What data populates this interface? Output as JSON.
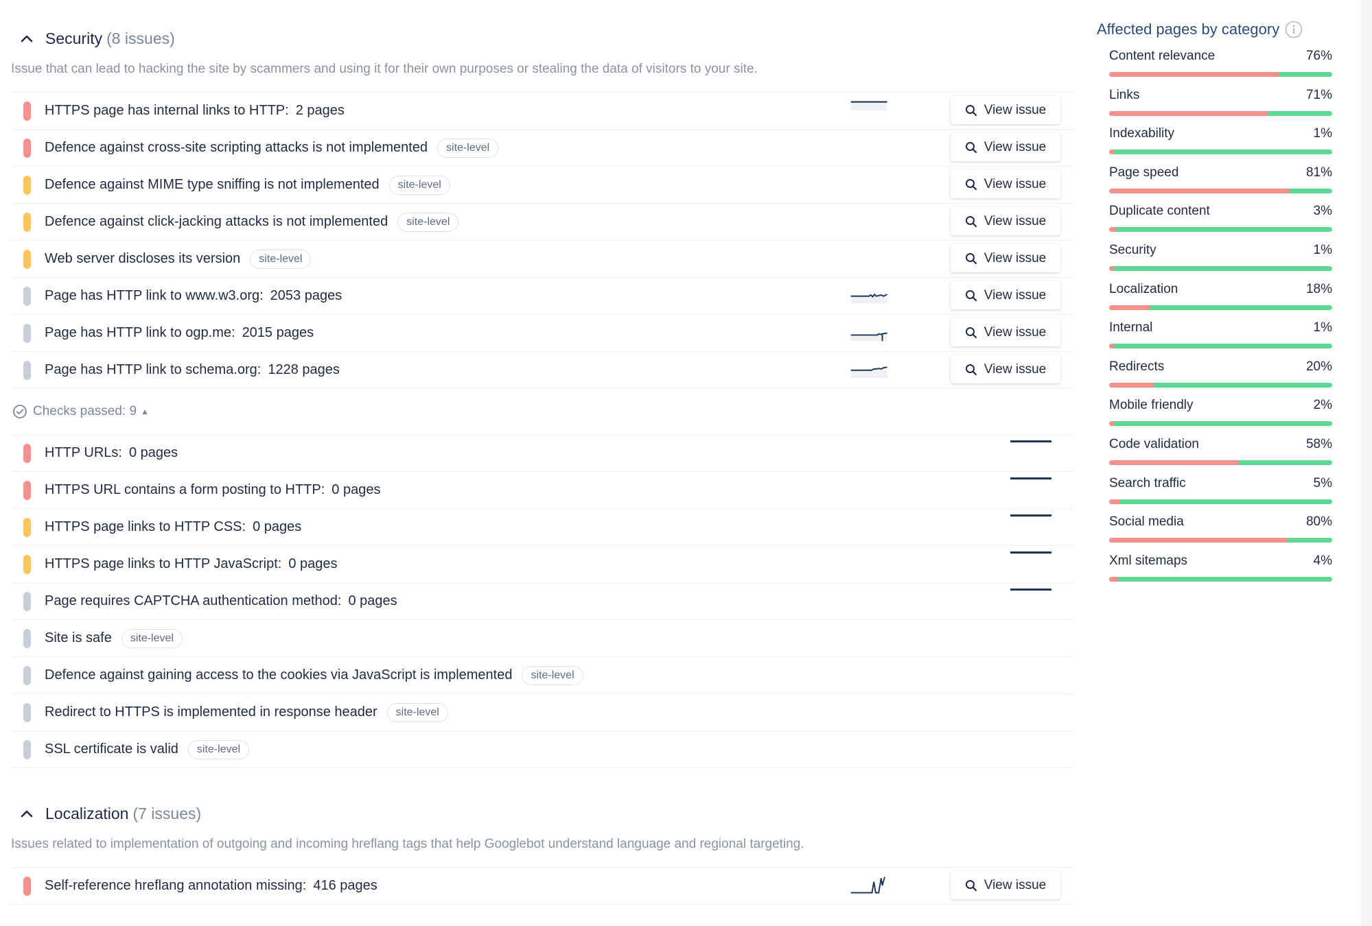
{
  "security": {
    "title": "Security",
    "count": "(8 issues)",
    "description": "Issue that can lead to hacking the site by scammers and using it for their own purposes or stealing the data of visitors to your site.",
    "issues": [
      {
        "severity": "red",
        "title": "HTTPS page has internal links to HTTP:",
        "count": "2 pages",
        "sparkline": "flat-low"
      },
      {
        "severity": "red",
        "title": "Defence against cross-site scripting attacks is not implemented",
        "tag": "site-level"
      },
      {
        "severity": "orange",
        "title": "Defence against MIME type sniffing is not implemented",
        "tag": "site-level"
      },
      {
        "severity": "orange",
        "title": "Defence against click-jacking attacks is not implemented",
        "tag": "site-level"
      },
      {
        "severity": "orange",
        "title": "Web server discloses its version",
        "tag": "site-level"
      },
      {
        "severity": "grey",
        "title": "Page has HTTP link to www.w3.org:",
        "count": "2053 pages",
        "sparkline": "wave"
      },
      {
        "severity": "grey",
        "title": "Page has HTTP link to ogp.me:",
        "count": "2015 pages",
        "sparkline": "hook"
      },
      {
        "severity": "grey",
        "title": "Page has HTTP link to schema.org:",
        "count": "1228 pages",
        "sparkline": "rise"
      }
    ],
    "view_label": "View issue",
    "checks_passed_label": "Checks passed: 9",
    "passed": [
      {
        "severity": "red",
        "title": "HTTP URLs:",
        "count": "0 pages",
        "flat": true
      },
      {
        "severity": "red",
        "title": "HTTPS URL contains a form posting to HTTP:",
        "count": "0 pages",
        "flat": true
      },
      {
        "severity": "orange",
        "title": "HTTPS page links to HTTP CSS:",
        "count": "0 pages",
        "flat": true
      },
      {
        "severity": "orange",
        "title": "HTTPS page links to HTTP JavaScript:",
        "count": "0 pages",
        "flat": true
      },
      {
        "severity": "grey",
        "title": "Page requires CAPTCHA authentication method:",
        "count": "0 pages",
        "flat": true
      },
      {
        "severity": "grey",
        "title": "Site is safe",
        "tag": "site-level"
      },
      {
        "severity": "grey",
        "title": "Defence against gaining access to the cookies via JavaScript is implemented",
        "tag": "site-level"
      },
      {
        "severity": "grey",
        "title": "Redirect to HTTPS is implemented in response header",
        "tag": "site-level"
      },
      {
        "severity": "grey",
        "title": "SSL certificate is valid",
        "tag": "site-level"
      }
    ]
  },
  "localization": {
    "title": "Localization",
    "count": "(7 issues)",
    "description": "Issues related to implementation of outgoing and incoming hreflang tags that help Googlebot understand language and regional targeting.",
    "issues": [
      {
        "severity": "red",
        "title": "Self-reference hreflang annotation missing:",
        "count": "416 pages",
        "sparkline": "spike"
      }
    ]
  },
  "sidebar": {
    "title": "Affected pages by category",
    "categories": [
      {
        "name": "Content relevance",
        "value": "76%",
        "pct": 76
      },
      {
        "name": "Links",
        "value": "71%",
        "pct": 71
      },
      {
        "name": "Indexability",
        "value": "1%",
        "pct": 1
      },
      {
        "name": "Page speed",
        "value": "81%",
        "pct": 81
      },
      {
        "name": "Duplicate content",
        "value": "3%",
        "pct": 3
      },
      {
        "name": "Security",
        "value": "1%",
        "pct": 1
      },
      {
        "name": "Localization",
        "value": "18%",
        "pct": 18
      },
      {
        "name": "Internal",
        "value": "1%",
        "pct": 1
      },
      {
        "name": "Redirects",
        "value": "20%",
        "pct": 20
      },
      {
        "name": "Mobile friendly",
        "value": "2%",
        "pct": 2
      },
      {
        "name": "Code validation",
        "value": "58%",
        "pct": 58
      },
      {
        "name": "Search traffic",
        "value": "5%",
        "pct": 5
      },
      {
        "name": "Social media",
        "value": "80%",
        "pct": 80
      },
      {
        "name": "Xml sitemaps",
        "value": "4%",
        "pct": 4
      }
    ]
  },
  "colors": {
    "red": "#f78f8f",
    "orange": "#ffc55c",
    "grey": "#c9ced8",
    "good": "#5fd893",
    "bad": "#f7918a",
    "spark": "#1f3658"
  }
}
